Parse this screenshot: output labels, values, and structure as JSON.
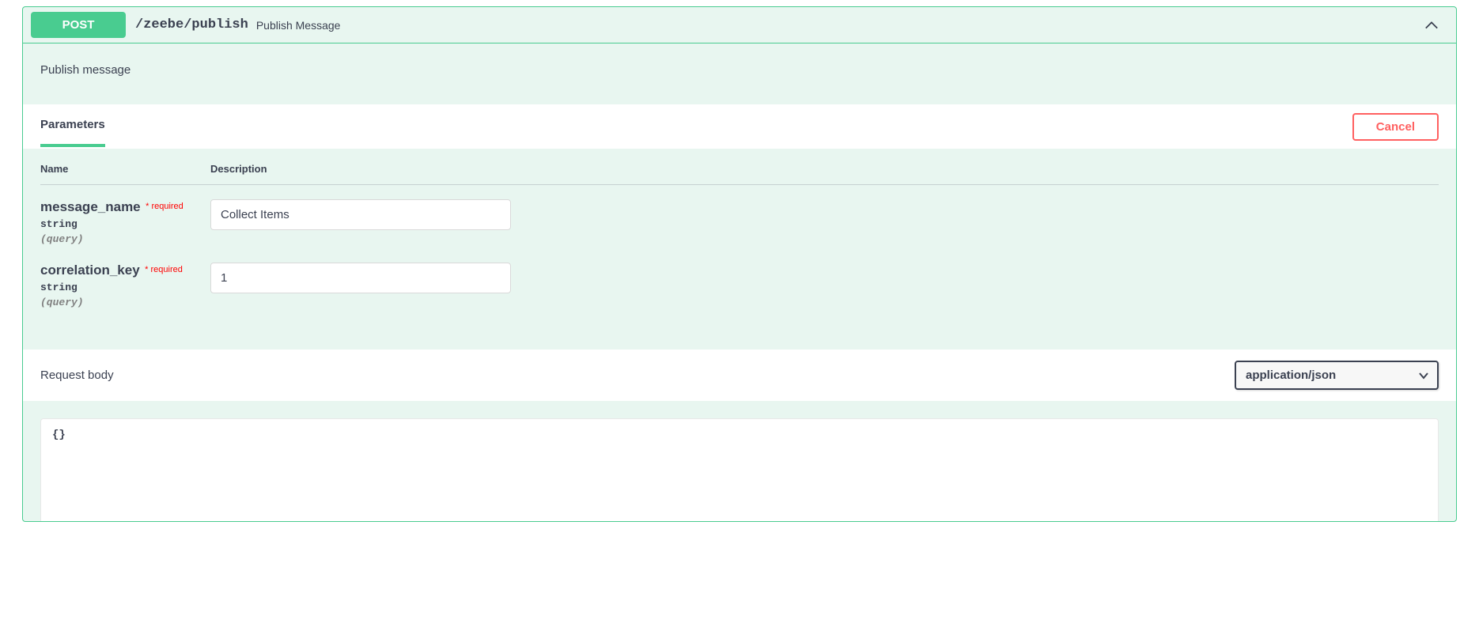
{
  "endpoint": {
    "method": "POST",
    "path": "/zeebe/publish",
    "summary": "Publish Message",
    "description": "Publish message"
  },
  "tabs": {
    "parameters_label": "Parameters",
    "cancel_label": "Cancel"
  },
  "params_table": {
    "col_name": "Name",
    "col_desc": "Description"
  },
  "parameters": [
    {
      "name": "message_name",
      "required_label": "required",
      "type": "string",
      "location": "(query)",
      "value": "Collect Items"
    },
    {
      "name": "correlation_key",
      "required_label": "required",
      "type": "string",
      "location": "(query)",
      "value": "1"
    }
  ],
  "request_body": {
    "label": "Request body",
    "content_type": "application/json",
    "body": "{}"
  }
}
